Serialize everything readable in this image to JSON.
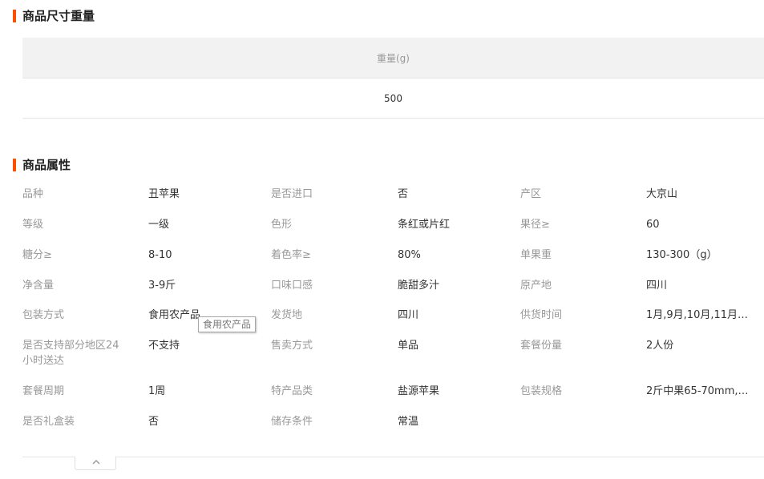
{
  "size_section": {
    "title": "商品尺寸重量",
    "table": {
      "header": "重量(g)",
      "value": "500"
    }
  },
  "attr_section": {
    "title": "商品属性",
    "rows": [
      [
        [
          "品种",
          "丑苹果"
        ],
        [
          "是否进口",
          "否"
        ],
        [
          "产区",
          "大京山"
        ]
      ],
      [
        [
          "等级",
          "一级"
        ],
        [
          "色形",
          "条红或片红"
        ],
        [
          "果径≥",
          "60"
        ]
      ],
      [
        [
          "糖分≥",
          "8-10"
        ],
        [
          "着色率≥",
          "80%"
        ],
        [
          "单果重",
          "130-300（g）"
        ]
      ],
      [
        [
          "净含量",
          "3-9斤"
        ],
        [
          "口味口感",
          "脆甜多汁"
        ],
        [
          "原产地",
          "四川"
        ]
      ],
      [
        [
          "包装方式",
          "食用农产品"
        ],
        [
          "发货地",
          "四川"
        ],
        [
          "供货时间",
          "1月,9月,10月,11月,1..."
        ]
      ],
      [
        [
          "是否支持部分地区24小时送达",
          "不支持"
        ],
        [
          "售卖方式",
          "单品"
        ],
        [
          "套餐份量",
          "2人份"
        ]
      ],
      [
        [
          "套餐周期",
          "1周"
        ],
        [
          "特产品类",
          "盐源苹果"
        ],
        [
          "包装规格",
          "2斤中果65-70mm,彩..."
        ]
      ],
      [
        [
          "是否礼盒装",
          "否"
        ],
        [
          "储存条件",
          "常温"
        ]
      ]
    ],
    "tooltip": "食用农产品"
  },
  "collapse_toggle": {
    "icon": "chevron-up-icon"
  },
  "colors": {
    "accent": "#ff5000",
    "label": "#999999",
    "text": "#333333",
    "table_header_bg": "#f2f2f2",
    "border": "#e5e5e5"
  }
}
